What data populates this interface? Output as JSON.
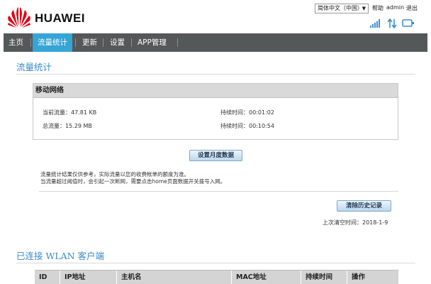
{
  "header": {
    "brand": "HUAWEI",
    "language": "简体中文（中国）",
    "help": "帮助",
    "user": "admin",
    "logout": "退出"
  },
  "status_icons": [
    "signal-bars-icon",
    "data-updown-icon",
    "device-icon"
  ],
  "nav": {
    "items": [
      {
        "label": "主页"
      },
      {
        "label": "流量统计"
      },
      {
        "label": "更新"
      },
      {
        "label": "设置"
      },
      {
        "label": "APP管理"
      }
    ],
    "active_index": 1
  },
  "traffic": {
    "title": "流量统计",
    "panel_title": "移动网络",
    "current_label": "当前流量：",
    "current_value": "47.81 KB",
    "current_duration_label": "持续时间：",
    "current_duration_value": "00:01:02",
    "total_label": "总流量：",
    "total_value": "15.29 MB",
    "total_duration_label": "持续时间：",
    "total_duration_value": "00:10:54",
    "set_monthly_button": "设置月度数据",
    "note_line1": "流量统计结果仅供参考，实际流量以您的收费帐单的额度为准。",
    "note_line2": "当流量超过阈值时，会引起一次断网，需要点击home页面数据开关拨号入网。",
    "clear_history_button": "清除历史记录",
    "last_cleared_label": "上次清空时间：",
    "last_cleared_value": "2018-1-9"
  },
  "wlan": {
    "title": "已连接 WLAN 客户端",
    "columns": [
      "ID",
      "IP地址",
      "主机名",
      "MAC地址",
      "持续时间",
      "操作"
    ]
  },
  "colors": {
    "nav_bg": "#555859",
    "nav_active": "#35a5d5",
    "section_title": "#3b8cc6",
    "logo_red": "#e60012"
  }
}
